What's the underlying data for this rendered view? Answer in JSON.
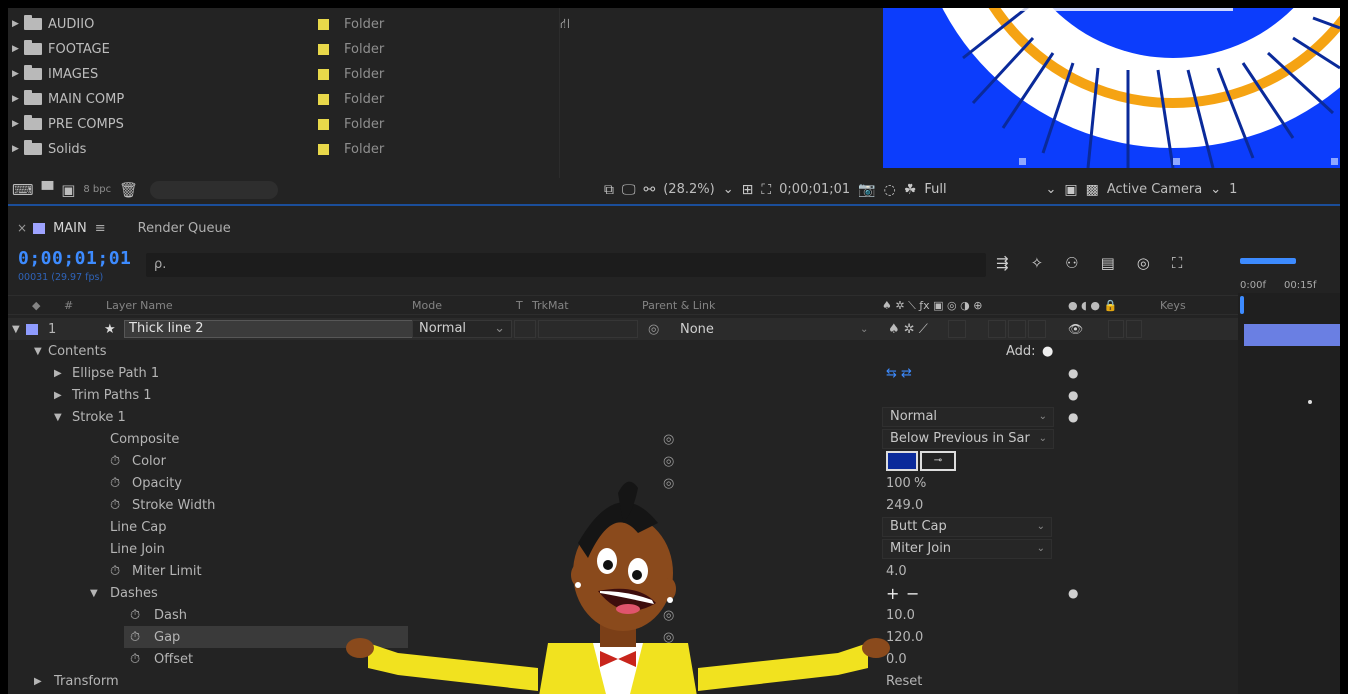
{
  "project": {
    "items": [
      {
        "name": "AUDIIO",
        "type": "Folder"
      },
      {
        "name": "FOOTAGE",
        "type": "Folder"
      },
      {
        "name": "IMAGES",
        "type": "Folder"
      },
      {
        "name": "MAIN COMP",
        "type": "Folder"
      },
      {
        "name": "PRE COMPS",
        "type": "Folder"
      },
      {
        "name": "Solids",
        "type": "Folder"
      }
    ],
    "bpc": "8 bpc",
    "folder_color": "#e8d84a"
  },
  "viewer": {
    "zoom": "(28.2%)",
    "timecode": "0;00;01;01",
    "resolution": "Full",
    "camera": "Active Camera",
    "extra": "1",
    "canvas_color": "#0c3dfc"
  },
  "timeline": {
    "tabs": {
      "main": "MAIN",
      "render_queue": "Render Queue"
    },
    "timecode": "0;00;01;01",
    "fps": "00031 (29.97 fps)",
    "search_placeholder": "ρ.",
    "columns": {
      "num": "#",
      "layer_name": "Layer Name",
      "mode": "Mode",
      "t": "T",
      "trkmat": "TrkMat",
      "parent": "Parent & Link",
      "keys": "Keys"
    },
    "ruler": {
      "start": "0:00f",
      "mark": "00:15f"
    },
    "layer": {
      "index": "1",
      "name": "Thick line 2",
      "mode": "Normal",
      "parent": "None"
    },
    "add_label": "Add:",
    "properties": {
      "contents": "Contents",
      "ellipse_path": "Ellipse Path 1",
      "trim_paths": "Trim Paths 1",
      "stroke": "Stroke 1",
      "stroke_mode": "Normal",
      "composite": "Composite",
      "composite_value": "Below Previous in Sar",
      "color": "Color",
      "color_value": "#0a2a9a",
      "opacity": "Opacity",
      "opacity_value": "100",
      "opacity_unit": "%",
      "stroke_width": "Stroke Width",
      "stroke_width_value": "249.0",
      "line_cap": "Line Cap",
      "line_cap_value": "Butt Cap",
      "line_join": "Line Join",
      "line_join_value": "Miter Join",
      "miter_limit": "Miter Limit",
      "miter_limit_value": "4.0",
      "dashes": "Dashes",
      "dash": "Dash",
      "dash_value": "10.0",
      "gap": "Gap",
      "gap_value": "120.0",
      "offset": "Offset",
      "offset_value": "0.0",
      "transform": "Transform",
      "transform_value": "Reset"
    }
  }
}
